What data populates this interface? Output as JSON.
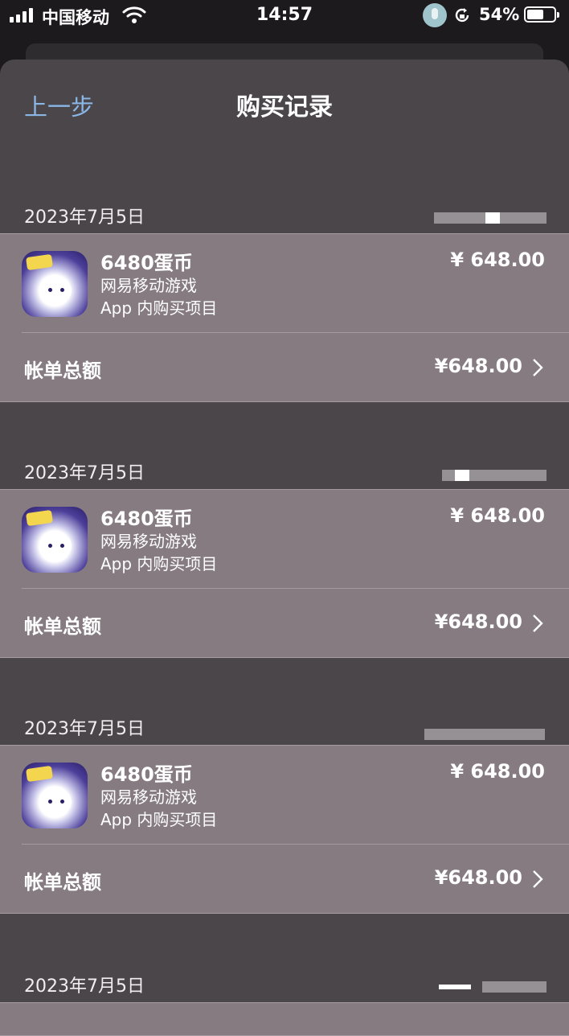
{
  "status_bar": {
    "carrier": "中国移动",
    "time": "14:57",
    "battery": "54%",
    "battery_level": 0.54
  },
  "nav": {
    "back_label": "上一步",
    "title": "购买记录"
  },
  "purchases": [
    {
      "date": "2023年7月5日",
      "item_name": "6480蛋币",
      "developer": "网易移动游戏",
      "item_type": "App 内购买项目",
      "price": "¥ 648.00",
      "total_label": "帐单总额",
      "total": "¥648.00"
    },
    {
      "date": "2023年7月5日",
      "item_name": "6480蛋币",
      "developer": "网易移动游戏",
      "item_type": "App 内购买项目",
      "price": "¥ 648.00",
      "total_label": "帐单总额",
      "total": "¥648.00"
    },
    {
      "date": "2023年7月5日",
      "item_name": "6480蛋币",
      "developer": "网易移动游戏",
      "item_type": "App 内购买项目",
      "price": "¥ 648.00",
      "total_label": "帐单总额",
      "total": "¥648.00"
    },
    {
      "date": "2023年7月5日"
    }
  ],
  "icons": {
    "signal": "cellular-signal-icon",
    "wifi": "wifi-icon",
    "mic": "microphone-icon",
    "rotation_lock": "rotation-lock-icon",
    "battery": "battery-icon",
    "chevron": "chevron-right-icon",
    "app": "game-app-icon"
  },
  "colors": {
    "accent": "#8ab6e6",
    "card_bg": "#857b80",
    "sheet_bg": "#4b4649"
  }
}
